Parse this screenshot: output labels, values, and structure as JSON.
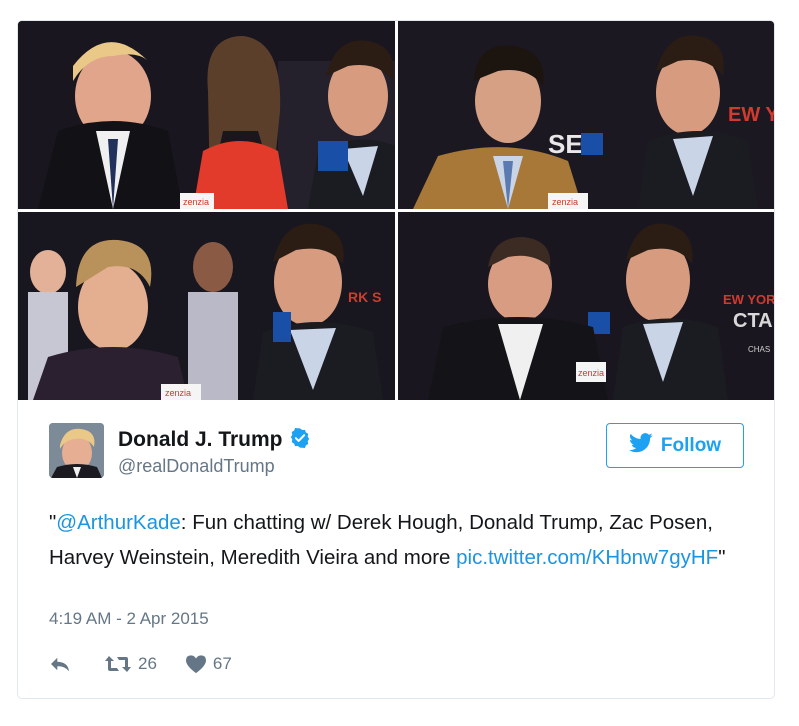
{
  "tweet": {
    "display_name": "Donald J. Trump",
    "handle": "@realDonaldTrump",
    "follow_label": "Follow",
    "text": {
      "quote_open": "\"",
      "mention": "@ArthurKade",
      "body": ": Fun chatting w/ Derek Hough, Donald Trump, Zac Posen, Harvey Weinstein, Meredith Vieira and more ",
      "link": "pic.twitter.com/KHbnw7gyHF",
      "quote_close": "\""
    },
    "timestamp": "4:19 AM - 2 Apr 2015",
    "retweet_count": "26",
    "like_count": "67"
  },
  "photos": {
    "microphone_label": "zenzia",
    "sign_text_1": "SE",
    "sign_text_2": "EW Y",
    "sign_text_3": "RK S",
    "sign_text_4": "EW YOR",
    "sign_text_5": "CTA",
    "sign_text_6": "CHAS"
  },
  "colors": {
    "twitter_blue": "#1da1f2",
    "link_blue": "#1b95e0",
    "secondary_text": "#657786",
    "like_heart": "#657786"
  },
  "icons": {
    "verified": "verified-badge-icon",
    "follow": "bird-icon",
    "reply": "reply-icon",
    "retweet": "retweet-icon",
    "like": "heart-icon"
  }
}
